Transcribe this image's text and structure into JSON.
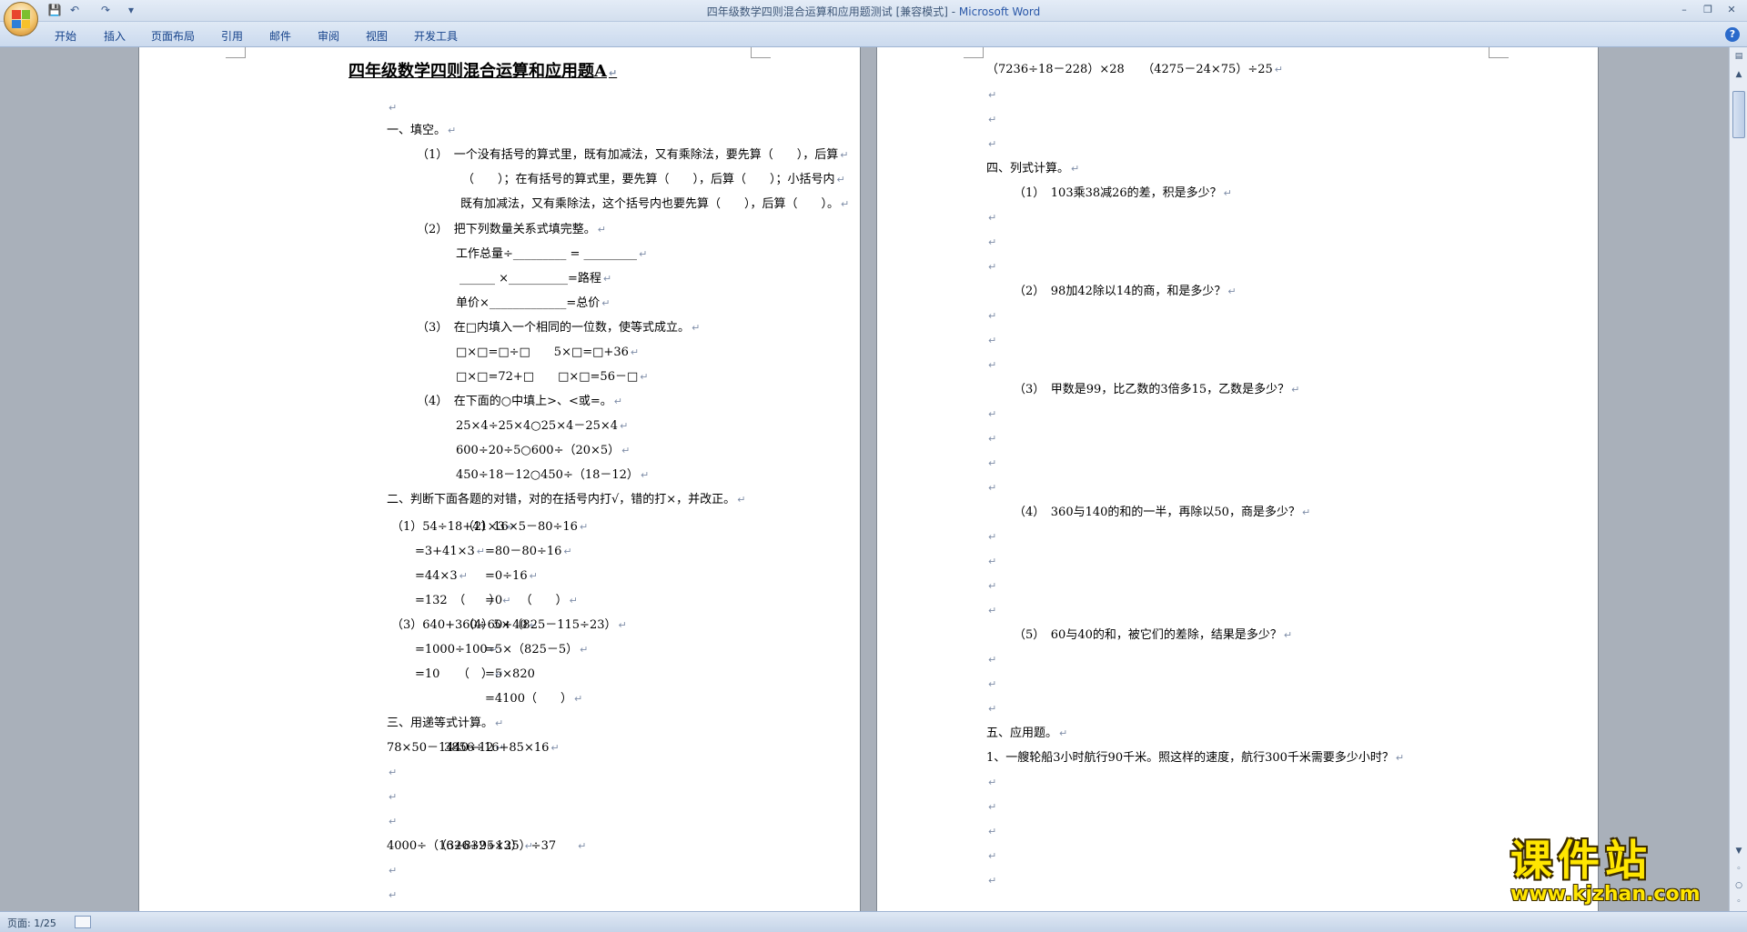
{
  "window": {
    "title": "四年级数学四则混合运算和应用题测试 [兼容模式] - ",
    "app_name": "Microsoft Word",
    "minimize": "–",
    "restore": "❐",
    "close": "✕"
  },
  "qat": {
    "save": "💾",
    "undo": "↶",
    "redo": "↷",
    "more": "▾"
  },
  "ribbon": {
    "tabs": [
      "开始",
      "插入",
      "页面布局",
      "引用",
      "邮件",
      "审阅",
      "视图",
      "开发工具"
    ],
    "help": "?"
  },
  "paragraph_mark": "↵",
  "page1": {
    "title": "四年级数学四则混合运算和应用题A",
    "lines": [
      "",
      "一、填空。",
      "（1）　一个没有括号的算式里，既有加减法，又有乘除法，要先算（　　），后算",
      "（　　）；在有括号的算式里，要先算（　　），后算（　　）；小括号内",
      "既有加减法，又有乘除法，这个括号内也要先算（　　），后算（　　）。",
      "（2）　把下列数量关系式填完整。",
      "工作总量÷_________ = _________",
      "______ ×__________=路程",
      "单价×_____________=总价",
      "（3）　在□内填入一个相同的一位数，使等式成立。",
      "□×□=□÷□　　5×□=□+36",
      "□×□=72+□　　□×□=56－□",
      "（4）　在下面的○中填上>、<或=。",
      "25×4÷25×4○25×4－25×4",
      "600÷20÷5○600÷（20×5）",
      "450÷18－12○450÷（18－12）",
      "二、判断下面各题的对错，对的在括号内打√，错的打×，并改正。",
      "（1）54÷18+41×3",
      "=3+41×3",
      "=44×3",
      "=132　（　　）",
      "（3）640+360÷60+40",
      "=1000÷100",
      "=10　　（　）",
      "三、用递等式计算。",
      "78×50－1440÷12",
      "",
      "",
      "",
      "4000÷（16+832÷13）",
      "",
      ""
    ],
    "right_col": [
      "（2）16×5－80÷16",
      "=80－80÷16",
      "=0÷16",
      "=0　　（　　）",
      "（4）5×（825－115÷23）",
      "=5×（825－5）",
      "=5×820",
      "=4100（　　）",
      "3856÷16+85×16",
      "（326+95×25）÷37"
    ]
  },
  "page2": {
    "lines": [
      "（7236÷18－228）×28　　（4275－24×75）÷25",
      "四、列式计算。",
      "（1）　103乘38减26的差，积是多少？",
      "（2）　98加42除以14的商，和是多少？",
      "（3）　甲数是99，比乙数的3倍多15，乙数是多少？",
      "（4）　360与140的和的一半，再除以50，商是多少？",
      "（5）　60与40的和，被它们的差除，结果是多少？",
      "五、应用题。",
      "1、一艘轮船3小时航行90千米。照这样的速度，航行300千米需要多少小时？"
    ]
  },
  "status": {
    "page": "页面: 1/25"
  },
  "watermark": {
    "top": "课件站",
    "bottom": "www.kjzhan.com"
  },
  "scroll": {
    "up": "▲",
    "down": "▼",
    "prev": "◦",
    "next": "◦"
  }
}
